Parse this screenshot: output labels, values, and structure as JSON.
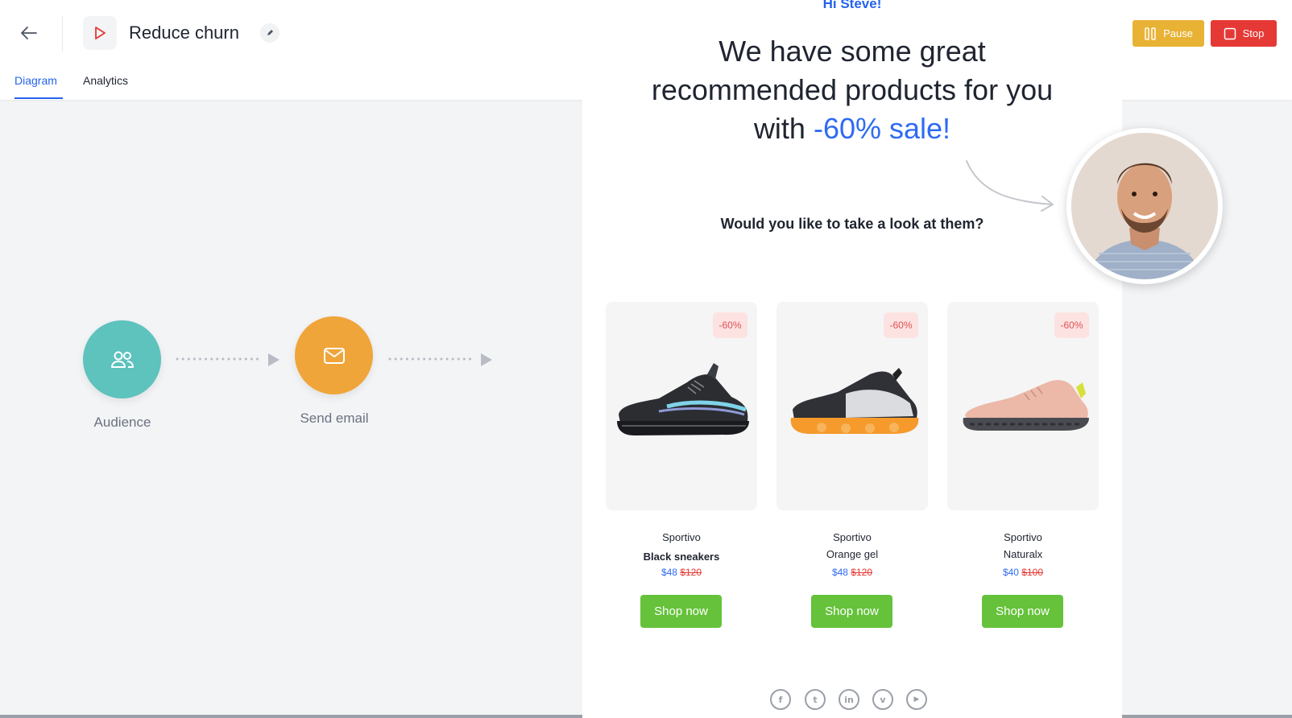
{
  "header": {
    "title": "Reduce churn",
    "tabs": [
      {
        "label": "Diagram",
        "active": true
      },
      {
        "label": "Analytics",
        "active": false
      }
    ],
    "pause_label": "Pause",
    "stop_label": "Stop",
    "accent_color": "#2563eb",
    "pause_color": "#e8b234",
    "stop_color": "#e53935"
  },
  "diagram": {
    "nodes": [
      {
        "label": "Audience",
        "icon": "users-icon",
        "color": "#5ec2bd"
      },
      {
        "label": "Send email",
        "icon": "mail-icon",
        "color": "#f0a53a"
      }
    ]
  },
  "email": {
    "greeting": "Hi Steve!",
    "headline_part1": "We have some great recommended products for you with ",
    "headline_highlight": "-60% sale!",
    "question": "Would you like to take a look at them?",
    "products": [
      {
        "badge": "-60%",
        "brand": "Sportivo",
        "name": "Black sneakers",
        "price_now": "$48",
        "price_was": "$120",
        "cta": "Shop now"
      },
      {
        "badge": "-60%",
        "brand": "Sportivo",
        "name": "Orange gel",
        "price_now": "$48",
        "price_was": "$120",
        "cta": "Shop now"
      },
      {
        "badge": "-60%",
        "brand": "Sportivo",
        "name": "Naturalx",
        "price_now": "$40",
        "price_was": "$100",
        "cta": "Shop now"
      }
    ],
    "social": [
      {
        "icon": "facebook-icon",
        "glyph": "f"
      },
      {
        "icon": "twitter-icon",
        "glyph": "t"
      },
      {
        "icon": "linkedin-icon",
        "glyph": "in"
      },
      {
        "icon": "vimeo-icon",
        "glyph": "v"
      },
      {
        "icon": "youtube-icon",
        "glyph": "▶"
      }
    ],
    "cta_color": "#65c23a"
  }
}
